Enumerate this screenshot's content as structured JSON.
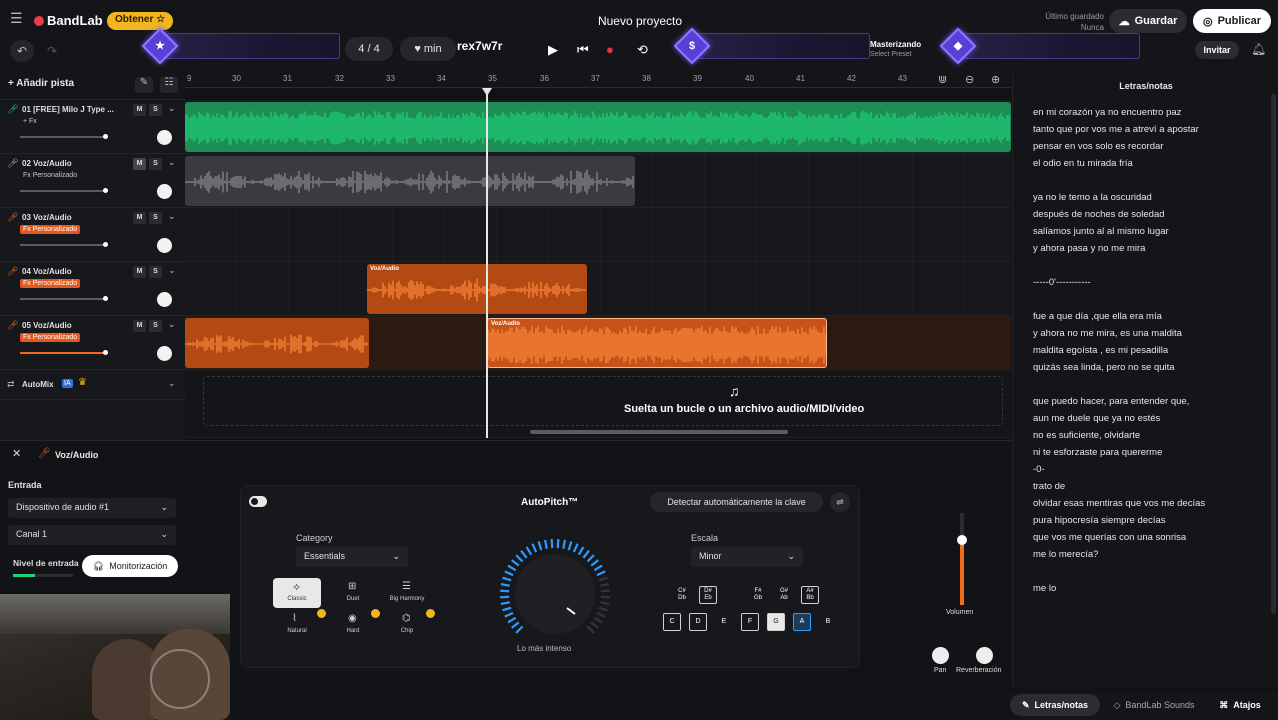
{
  "topbar": {
    "logo": "BandLab",
    "obtener": "Obtener",
    "title": "Nuevo proyecto",
    "saved_line1": "Último guardado",
    "saved_line2": "Nunca",
    "guardar": "Guardar",
    "publicar": "Publicar",
    "invitar": "Invitar",
    "time_sig": "4 / 4",
    "tempo_unit": "min",
    "key_text": "rex7w7r",
    "mastering_title": "Masterizando",
    "mastering_sub": "Select Preset"
  },
  "tracks_toolbar": {
    "add_track": "Añadir pista"
  },
  "ruler": [
    "9",
    "30",
    "31",
    "32",
    "33",
    "34",
    "35",
    "36",
    "37",
    "38",
    "39",
    "40",
    "41",
    "42",
    "43"
  ],
  "tracks": [
    {
      "name": "01  [FREE] Milo J Type ...",
      "fx": "+ Fx",
      "fx_style": "plain"
    },
    {
      "name": "02  Voz/Audio",
      "fx": "Fx  Personalizado",
      "fx_style": "plain"
    },
    {
      "name": "03  Voz/Audio",
      "fx": "Fx  Personalizado",
      "fx_style": "org"
    },
    {
      "name": "04  Voz/Audio",
      "fx": "Fx  Personalizado",
      "fx_style": "org"
    },
    {
      "name": "05  Voz/Audio",
      "fx": "Fx  Personalizado",
      "fx_style": "org"
    }
  ],
  "mute_label": "M",
  "solo_label": "S",
  "automix": {
    "label": "AutoMix",
    "badge": "IA"
  },
  "clip_labels": {
    "clip4": "Voz/Audio",
    "clip5": "Voz/Audio"
  },
  "drop_zone": "Suelta un bucle o un archivo audio/MIDI/video",
  "lyrics": {
    "title": "Letras/notas",
    "lines": [
      "en mi corazón ya no encuentro paz",
      "tanto que por vos me a  atreví a apostar",
      "pensar en vos solo es recordar",
      "el odio en tu mirada fría",
      "",
      "ya no le temo a la oscuridad",
      "después de noches de soledad",
      "salíamos junto al  al  mismo lugar",
      "y ahora pasa y no me mira",
      "",
      "-----0'-----------",
      "",
      "fue a que día ,que ella era mía",
      "y ahora no me mira, es una maldita",
      "maldita egoísta , es mi pesadilla",
      "quizás sea linda, pero no se quita",
      "",
      "que puedo hacer, para entender que,",
      "aun me duele que ya no estés",
      "no es suficiente, olvidarte",
      "ni te esforzaste para quererme",
      "-0-",
      "trato de",
      "olvidar esas mentiras que vos me decías",
      "pura hipocresía siempre decías",
      "que vos me querías con una sonrisa",
      "me lo merecía?",
      "",
      "me lo"
    ]
  },
  "panel": {
    "close": "✕",
    "track_title": "Voz/Audio",
    "input_label": "Entrada",
    "device": "Dispositivo de audio #1",
    "channel": "Canal 1",
    "level_label": "Nivel de entrada",
    "monitor": "Monitorización"
  },
  "autopitch": {
    "title": "AutoPitch™",
    "detect": "Detectar automáticamente la clave",
    "category_label": "Category",
    "category_value": "Essentials",
    "scale_label": "Escala",
    "scale_value": "Minor",
    "intensity_label": "Lo más intenso",
    "modes": [
      "Classic",
      "Duet",
      "Big Harmony",
      "Natural",
      "Hard",
      "Chip"
    ],
    "sharps": [
      "C#\nDb",
      "D#\nEb",
      "F#\nGb",
      "G#\nAb",
      "A#\nBb"
    ],
    "naturals": [
      "C",
      "D",
      "E",
      "F",
      "G",
      "A",
      "B"
    ],
    "intensity": 0.75
  },
  "mixer": {
    "volume": "Volumen",
    "pan": "Pan",
    "reverb": "Reverberación"
  },
  "bottom_tabs": [
    "Letras/notas",
    "BandLab Sounds",
    "Atajos"
  ],
  "colors": {
    "green": "#1ed27a",
    "orange": "#f26b1d",
    "gray": "#5f6166",
    "accent": "#2f9bff"
  }
}
